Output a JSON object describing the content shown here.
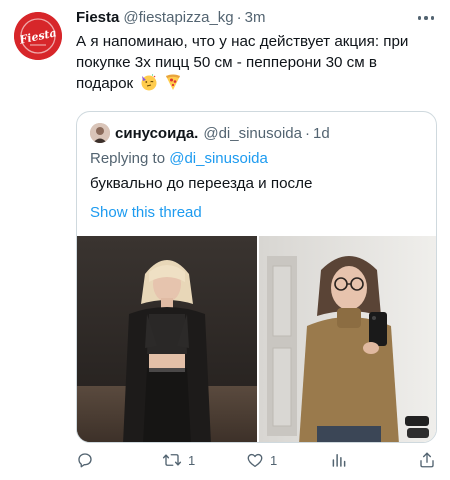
{
  "tweet": {
    "author_name": "Fiesta",
    "author_handle": "@fiestapizza_kg",
    "separator": "·",
    "time": "3m",
    "logo_text": "Fiesta",
    "text": "А я напоминаю, что у нас действует акция: при покупке 3х пицц 50 см - пепперони 30 см в подарок",
    "emojis": [
      "partying-face",
      "pizza"
    ]
  },
  "quote": {
    "author_name": "синусоида.",
    "author_handle": "@di_sinusoida",
    "separator": "·",
    "time": "1d",
    "replying_label": "Replying to",
    "replying_handle": "@di_sinusoida",
    "text": "буквально до переезда и после",
    "show_thread": "Show this thread",
    "photos": [
      "photo-before",
      "photo-after"
    ]
  },
  "actions": {
    "reply_count": "",
    "retweet_count": "1",
    "like_count": "1",
    "icons": [
      "reply-icon",
      "retweet-icon",
      "like-icon",
      "analytics-icon",
      "share-icon"
    ]
  },
  "colors": {
    "brand_red": "#d7262a",
    "link_blue": "#1d9bf0",
    "secondary_text": "#536471",
    "border": "#cfd9de"
  }
}
